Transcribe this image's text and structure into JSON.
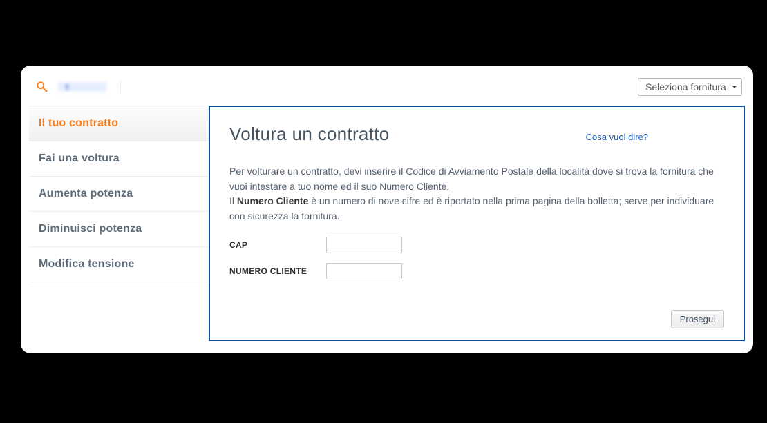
{
  "header": {
    "customer_ref": "5",
    "supply_selector_label": "Seleziona fornitura"
  },
  "sidebar": {
    "items": [
      {
        "label": "Il tuo contratto",
        "active": true
      },
      {
        "label": "Fai una voltura",
        "active": false
      },
      {
        "label": "Aumenta potenza",
        "active": false
      },
      {
        "label": "Diminuisci potenza",
        "active": false
      },
      {
        "label": "Modifica tensione",
        "active": false
      }
    ]
  },
  "panel": {
    "title": "Voltura un contratto",
    "help_link": "Cosa vuol dire?",
    "intro_part1": "Per volturare un contratto, devi inserire il Codice di Avviamento Postale della località dove si trova la fornitura che vuoi intestare a tuo nome ed il suo Numero Cliente.",
    "intro_part2a": "Il ",
    "intro_bold": "Numero Cliente",
    "intro_part2b": " è un numero di nove cifre ed è riportato nella prima pagina della bolletta; serve per individuare con sicurezza la fornitura.",
    "form": {
      "cap_label": "CAP",
      "cap_value": "",
      "numcli_label": "NUMERO CLIENTE",
      "numcli_value": ""
    },
    "submit_label": "Prosegui"
  }
}
